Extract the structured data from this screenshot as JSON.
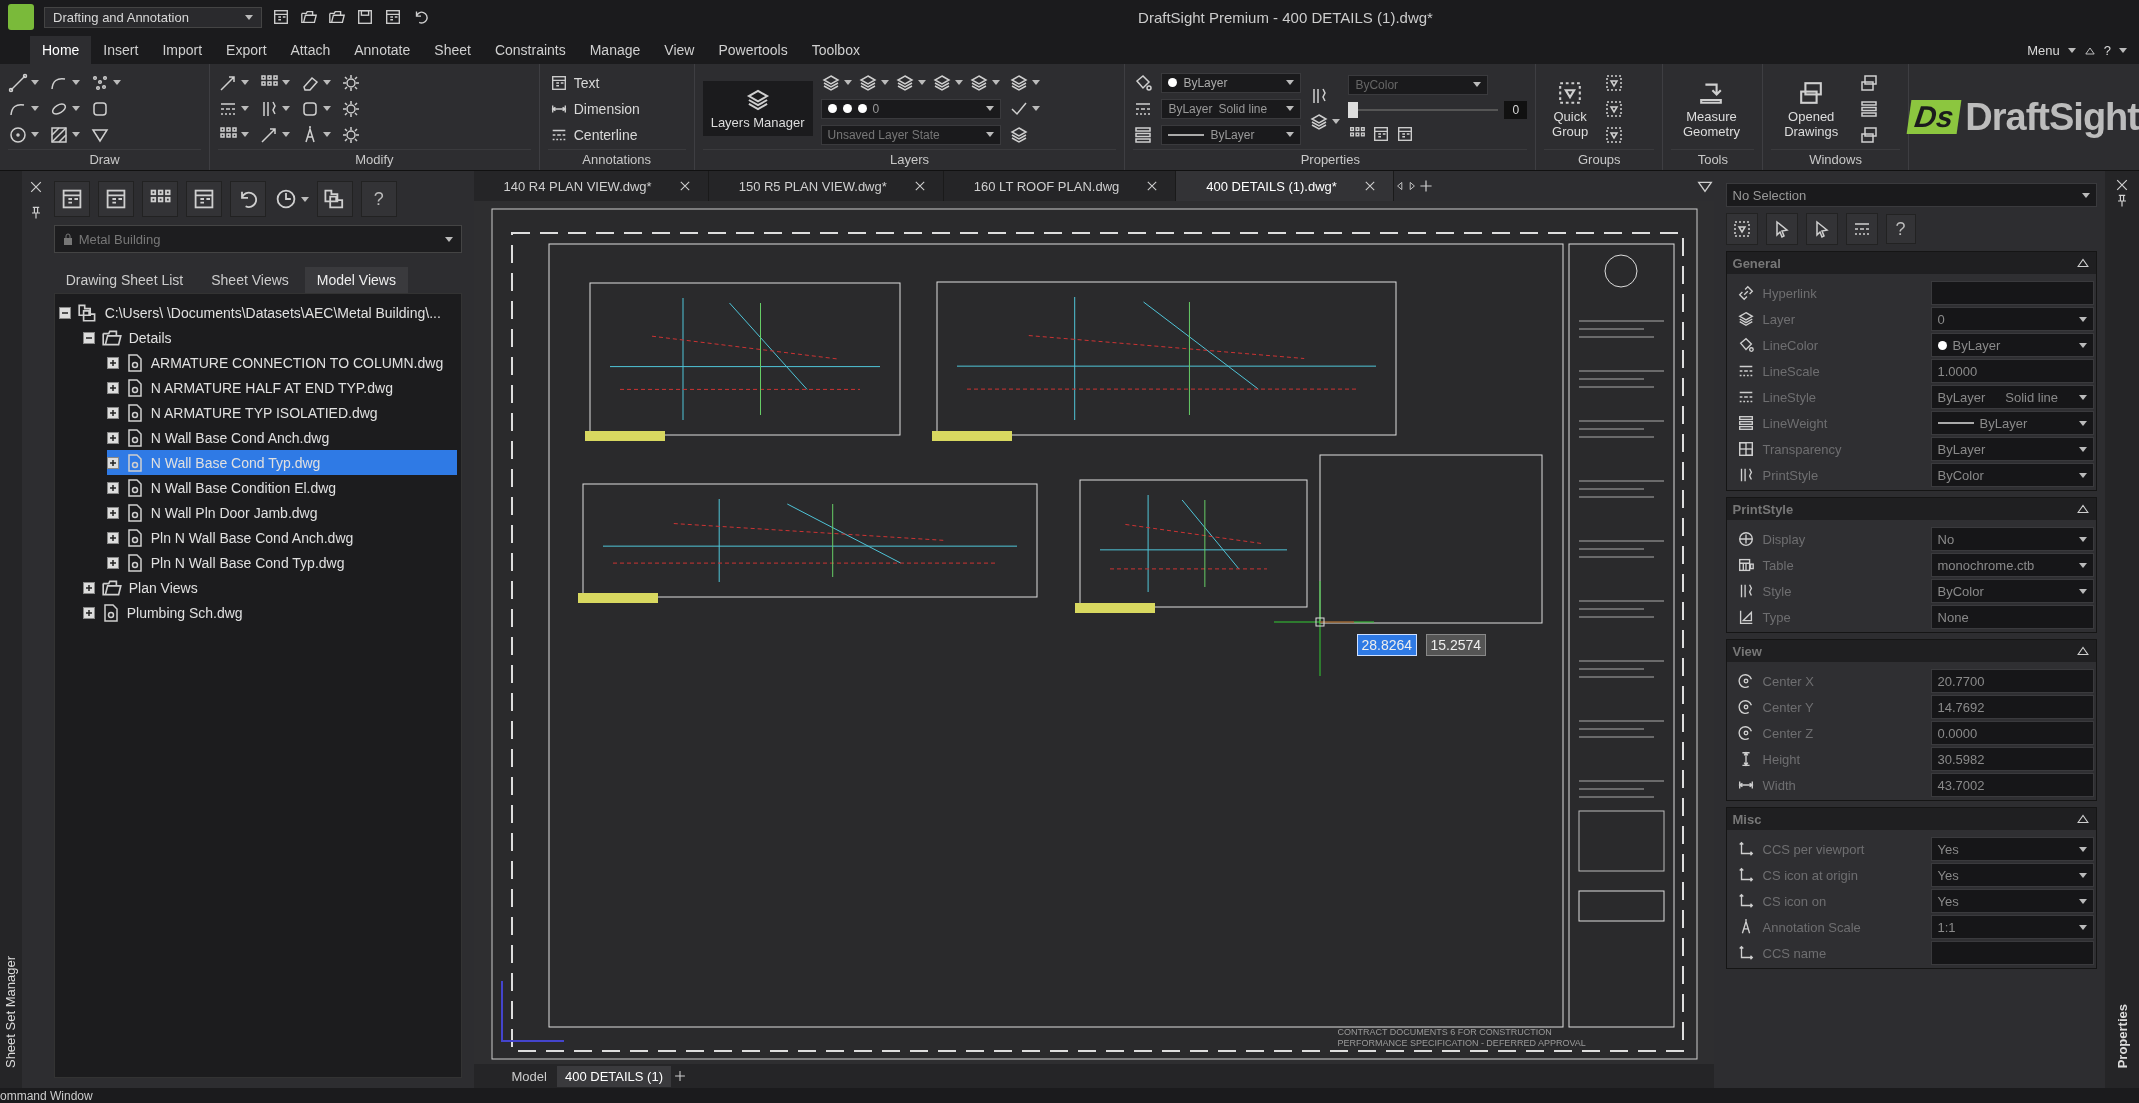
{
  "title_bar": {
    "workspace": "Drafting and Annotation",
    "title": "DraftSight Premium - 400 DETAILS (1).dwg*"
  },
  "ribbon_tabs": [
    {
      "label": "Home",
      "selected": true
    },
    {
      "label": "Insert",
      "selected": false
    },
    {
      "label": "Import",
      "selected": false
    },
    {
      "label": "Export",
      "selected": false
    },
    {
      "label": "Attach",
      "selected": false
    },
    {
      "label": "Annotate",
      "selected": false
    },
    {
      "label": "Sheet",
      "selected": false
    },
    {
      "label": "Constraints",
      "selected": false
    },
    {
      "label": "Manage",
      "selected": false
    },
    {
      "label": "View",
      "selected": false
    },
    {
      "label": "Powertools",
      "selected": false
    },
    {
      "label": "Toolbox",
      "selected": false
    }
  ],
  "menu": {
    "label": "Menu",
    "help": "?"
  },
  "ribbon": {
    "draw": {
      "title": "Draw"
    },
    "modify": {
      "title": "Modify"
    },
    "annotations": {
      "title": "Annotations",
      "buttons": [
        "Text",
        "Dimension",
        "Centerline"
      ]
    },
    "layers": {
      "title": "Layers",
      "manager": "Layers Manager",
      "layer": "0",
      "layer_state": "Unsaved Layer State"
    },
    "properties": {
      "title": "Properties",
      "line_color": "ByLayer",
      "linestyle": "ByLayer",
      "linestyle_name": "Solid line",
      "lineweight": "ByLayer",
      "printstyle": "ByColor",
      "transparency": "0",
      "level": 0.0
    },
    "groups": {
      "title": "Groups",
      "button": "Quick Group"
    },
    "tools": {
      "title": "Tools",
      "button": "Measure Geometry"
    },
    "windows": {
      "title": "Windows",
      "button": "Opened Drawings"
    }
  },
  "logo": {
    "mark": "Ds",
    "name": "DraftSight"
  },
  "sheet_set": {
    "side_label": "Sheet Set Manager",
    "help": "?",
    "project": "Metal Building",
    "tabs": [
      {
        "label": "Drawing Sheet List",
        "selected": false
      },
      {
        "label": "Sheet Views",
        "selected": false
      },
      {
        "label": "Model Views",
        "selected": true
      }
    ],
    "tree": [
      {
        "label": "C:\\Users\\  \\Documents\\Datasets\\AEC\\Metal Building\\...",
        "kind": "root",
        "expanded": true,
        "selected": false,
        "children": [
          {
            "label": "Details",
            "kind": "folder",
            "expanded": true,
            "selected": false,
            "children": [
              {
                "label": "ARMATURE CONNECTION TO COLUMN.dwg",
                "kind": "file",
                "expanded": false,
                "selected": false
              },
              {
                "label": "N ARMATURE HALF AT END TYP.dwg",
                "kind": "file",
                "expanded": false,
                "selected": false
              },
              {
                "label": "N ARMATURE TYP ISOLATIED.dwg",
                "kind": "file",
                "expanded": false,
                "selected": false
              },
              {
                "label": "N Wall Base Cond Anch.dwg",
                "kind": "file",
                "expanded": false,
                "selected": false
              },
              {
                "label": "N Wall Base Cond Typ.dwg",
                "kind": "file",
                "expanded": false,
                "selected": true
              },
              {
                "label": "N Wall Base Condition El.dwg",
                "kind": "file",
                "expanded": false,
                "selected": false
              },
              {
                "label": "N Wall Pln Door Jamb.dwg",
                "kind": "file",
                "expanded": false,
                "selected": false
              },
              {
                "label": "Pln N Wall Base Cond Anch.dwg",
                "kind": "file",
                "expanded": false,
                "selected": false
              },
              {
                "label": "Pln N Wall Base Cond Typ.dwg",
                "kind": "file",
                "expanded": false,
                "selected": false
              }
            ]
          },
          {
            "label": "Plan Views",
            "kind": "folder",
            "expanded": false,
            "selected": false
          },
          {
            "label": "Plumbing Sch.dwg",
            "kind": "file",
            "expanded": false,
            "selected": false
          }
        ]
      }
    ]
  },
  "drawing_tabs": [
    {
      "label": "140 R4 PLAN VIEW.dwg*",
      "selected": false
    },
    {
      "label": "150 R5 PLAN VIEW.dwg*",
      "selected": false
    },
    {
      "label": "160 LT ROOF PLAN.dwg",
      "selected": false
    },
    {
      "label": "400 DETAILS (1).dwg*",
      "selected": true
    }
  ],
  "canvas": {
    "coordinates": [
      {
        "value": "28.8264",
        "selected": true
      },
      {
        "value": "15.2574",
        "selected": false
      }
    ],
    "notes": [
      "CONTRACT DOCUMENTS 6 FOR CONSTRUCTION",
      "PERFORMANCE SPECIFICATION - DEFERRED APPROVAL"
    ]
  },
  "layout_tabs": [
    {
      "label": "Model",
      "selected": false
    },
    {
      "label": "400 DETAILS (1)",
      "selected": true
    }
  ],
  "properties": {
    "side_label": "Properties",
    "help": "?",
    "selection": "No Selection",
    "sections": [
      {
        "title": "General",
        "expanded": true,
        "rows": [
          {
            "label": "Hyperlink",
            "value": "",
            "kind": "field"
          },
          {
            "label": "Layer",
            "value": "0",
            "kind": "dropdown"
          },
          {
            "label": "LineColor",
            "value": "ByLayer",
            "kind": "color"
          },
          {
            "label": "LineScale",
            "value": "1.0000",
            "kind": "field"
          },
          {
            "label": "LineStyle",
            "value": "ByLayer",
            "extra": "Solid line",
            "kind": "dropdown"
          },
          {
            "label": "LineWeight",
            "value": "ByLayer",
            "kind": "weight"
          },
          {
            "label": "Transparency",
            "value": "ByLayer",
            "kind": "dropdown"
          },
          {
            "label": "PrintStyle",
            "value": "ByColor",
            "kind": "dropdown"
          }
        ]
      },
      {
        "title": "PrintStyle",
        "expanded": true,
        "rows": [
          {
            "label": "Display",
            "value": "No",
            "kind": "dropdown"
          },
          {
            "label": "Table",
            "value": "monochrome.ctb",
            "kind": "dropdown"
          },
          {
            "label": "Style",
            "value": "ByColor",
            "kind": "dropdown"
          },
          {
            "label": "Type",
            "value": "None",
            "kind": "field"
          }
        ]
      },
      {
        "title": "View",
        "expanded": true,
        "rows": [
          {
            "label": "Center X",
            "value": "20.7700",
            "kind": "field"
          },
          {
            "label": "Center Y",
            "value": "14.7692",
            "kind": "field"
          },
          {
            "label": "Center Z",
            "value": "0.0000",
            "kind": "field"
          },
          {
            "label": "Height",
            "value": "30.5982",
            "kind": "field"
          },
          {
            "label": "Width",
            "value": "43.7002",
            "kind": "field"
          }
        ]
      },
      {
        "title": "Misc",
        "expanded": true,
        "rows": [
          {
            "label": "CCS per viewport",
            "value": "Yes",
            "kind": "dropdown"
          },
          {
            "label": "CS icon at origin",
            "value": "Yes",
            "kind": "dropdown"
          },
          {
            "label": "CS icon on",
            "value": "Yes",
            "kind": "dropdown"
          },
          {
            "label": "Annotation Scale",
            "value": "1:1",
            "kind": "dropdown"
          },
          {
            "label": "CCS name",
            "value": "",
            "kind": "field"
          }
        ]
      }
    ]
  },
  "command_window": {
    "label": "ommand Window"
  }
}
